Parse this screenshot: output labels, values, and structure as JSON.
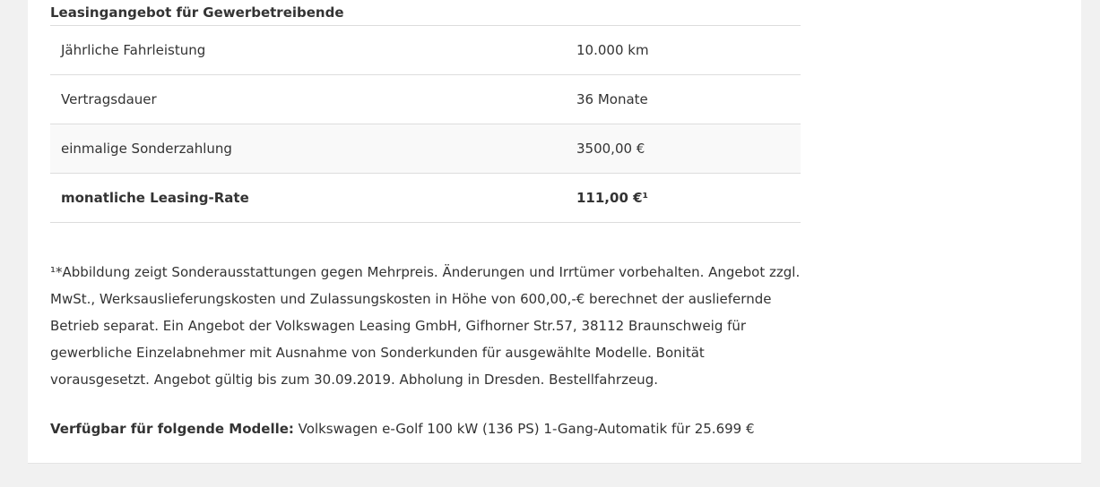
{
  "offer": {
    "title": "Leasingangebot für Gewerbetreibende",
    "rows": [
      {
        "label": "Jährliche Fahrleistung",
        "value": "10.000 km"
      },
      {
        "label": "Vertragsdauer",
        "value": "36 Monate"
      },
      {
        "label": "einmalige Sonderzahlung",
        "value": "3500,00 €"
      },
      {
        "label": "monatliche Leasing-Rate",
        "value": "111,00 €¹"
      }
    ]
  },
  "footnote": "¹*Abbildung zeigt Sonderausstattungen gegen Mehrpreis. Änderungen und Irrtümer vorbehalten. Angebot zzgl. MwSt., Werksauslieferungskosten und Zulassungskosten in Höhe von 600,00,-€ berechnet der ausliefernde Betrieb separat. Ein Angebot der Volkswagen Leasing GmbH, Gifhorner Str.57, 38112 Braunschweig für gewerbliche Einzelabnehmer mit Ausnahme von Sonderkunden für ausgewählte Modelle. Bonität vorausgesetzt. Angebot gültig bis zum 30.09.2019. Abholung in Dresden. Bestellfahrzeug.",
  "models": {
    "label": "Verfügbar für folgende Modelle:",
    "text": " Volkswagen e-Golf 100 kW (136 PS) 1-Gang-Automatik für 25.699 €"
  }
}
